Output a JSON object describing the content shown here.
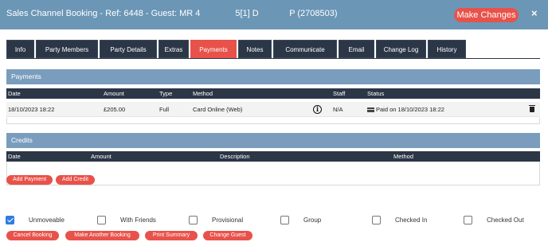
{
  "header": {
    "title": "Sales Channel Booking - Ref: 6448 - Guest: MR 4        5[1] D       P (2708503)",
    "make_changes": "Make Changes",
    "close": "×"
  },
  "tabs": [
    {
      "label": "Info"
    },
    {
      "label": "Party Members"
    },
    {
      "label": "Party Details"
    },
    {
      "label": "Extras"
    },
    {
      "label": "Payments",
      "active": true
    },
    {
      "label": "Notes"
    },
    {
      "label": "Communicate"
    },
    {
      "label": "Email"
    },
    {
      "label": "Change Log"
    },
    {
      "label": "History"
    }
  ],
  "payments": {
    "title": "Payments",
    "columns": [
      "Date",
      "Amount",
      "Type",
      "Method",
      "Staff",
      "Status"
    ],
    "rows": [
      {
        "date": "18/10/2023 18:22",
        "amount": "£205.00",
        "type": "Full",
        "method": "Card Online (Web)",
        "staff": "N/A",
        "status": "Paid on 18/10/2023 18:22"
      }
    ]
  },
  "credits": {
    "title": "Credits",
    "columns": [
      "Date",
      "Amount",
      "Description",
      "Method"
    ],
    "add_payment": "Add Payment",
    "add_credit": "Add Credit"
  },
  "flags": [
    {
      "label": "Unmoveable",
      "checked": true
    },
    {
      "label": "With Friends",
      "checked": false
    },
    {
      "label": "Provisional",
      "checked": false
    },
    {
      "label": "Group",
      "checked": false
    },
    {
      "label": "Checked In",
      "checked": false
    },
    {
      "label": "Checked Out",
      "checked": false
    }
  ],
  "actions": {
    "cancel_booking": "Cancel Booking",
    "make_another": "Make Another Booking",
    "print_summary": "Print Summary",
    "change_guest": "Change Guest"
  },
  "colors": {
    "header": "#6b96b6",
    "accent": "#e8524a",
    "tab_dark": "#2b3646",
    "check": "#2f7de1"
  }
}
